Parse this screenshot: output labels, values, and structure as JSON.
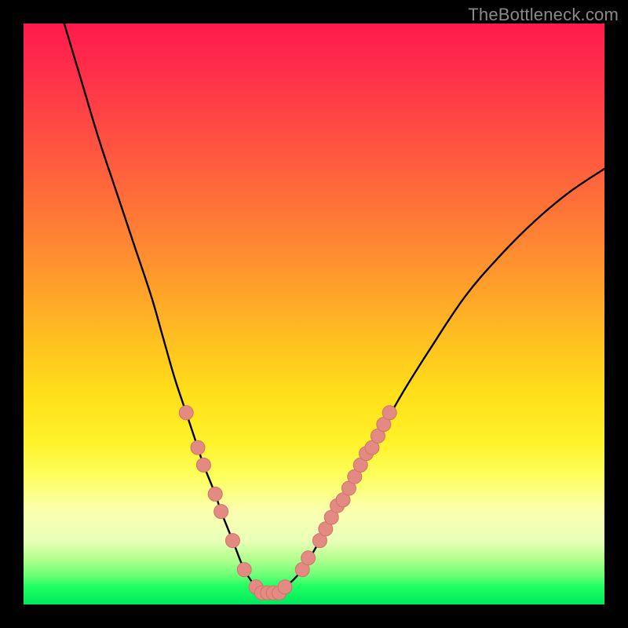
{
  "watermark": "TheBottleneck.com",
  "colors": {
    "background": "#000000",
    "curve_stroke": "#000000",
    "marker_fill": "#e38b82",
    "marker_stroke": "#d17269",
    "gradient_stops": [
      "#ff1a4d",
      "#ff7a36",
      "#ffe01a",
      "#fbffb0",
      "#00e85c"
    ]
  },
  "chart_data": {
    "type": "line",
    "title": "",
    "xlabel": "",
    "ylabel": "",
    "xlim": [
      0,
      100
    ],
    "ylim": [
      0,
      100
    ],
    "grid": false,
    "legend": false,
    "annotations": [],
    "series": [
      {
        "name": "bottleneck-curve",
        "x": [
          7,
          10,
          13,
          16,
          19,
          22,
          24,
          26,
          28,
          30,
          31,
          33,
          34,
          36,
          38,
          40,
          41,
          43,
          45,
          48,
          51,
          55,
          60,
          65,
          70,
          76,
          82,
          88,
          94,
          100
        ],
        "y": [
          100,
          90,
          80,
          71,
          62,
          53,
          46,
          39,
          33,
          27,
          24,
          19,
          16,
          11,
          6,
          3,
          2,
          2,
          3,
          6,
          11,
          18,
          27,
          36,
          44,
          53,
          60,
          66,
          71,
          75
        ]
      }
    ],
    "markers": {
      "name": "highlighted-points",
      "points": [
        {
          "x": 28,
          "y": 33
        },
        {
          "x": 30,
          "y": 27
        },
        {
          "x": 31,
          "y": 24
        },
        {
          "x": 33,
          "y": 19
        },
        {
          "x": 34,
          "y": 16
        },
        {
          "x": 36,
          "y": 11
        },
        {
          "x": 38,
          "y": 6
        },
        {
          "x": 40,
          "y": 3
        },
        {
          "x": 41,
          "y": 2
        },
        {
          "x": 42,
          "y": 2
        },
        {
          "x": 43,
          "y": 2
        },
        {
          "x": 44,
          "y": 2
        },
        {
          "x": 45,
          "y": 3
        },
        {
          "x": 48,
          "y": 6
        },
        {
          "x": 49,
          "y": 8
        },
        {
          "x": 51,
          "y": 11
        },
        {
          "x": 52,
          "y": 13
        },
        {
          "x": 53,
          "y": 15
        },
        {
          "x": 54,
          "y": 17
        },
        {
          "x": 55,
          "y": 18
        },
        {
          "x": 56,
          "y": 20
        },
        {
          "x": 57,
          "y": 22
        },
        {
          "x": 58,
          "y": 24
        },
        {
          "x": 59,
          "y": 26
        },
        {
          "x": 60,
          "y": 27
        },
        {
          "x": 61,
          "y": 29
        },
        {
          "x": 62,
          "y": 31
        },
        {
          "x": 63,
          "y": 33
        }
      ]
    }
  }
}
